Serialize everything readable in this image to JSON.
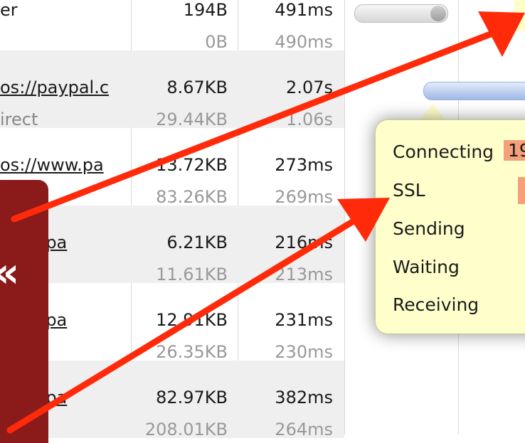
{
  "rows": [
    {
      "name": "er",
      "name_link": false,
      "sub": "",
      "size": "194B",
      "size_sub": "0B",
      "time": "491ms",
      "time_sub": "490ms",
      "shaded": false
    },
    {
      "name": "os://paypal.c",
      "name_link": true,
      "sub": "irect",
      "size": "8.67KB",
      "size_sub": "29.44KB",
      "time": "2.07s",
      "time_sub": "1.06s",
      "shaded": true
    },
    {
      "name": "os://www.pa",
      "name_link": true,
      "sub": "",
      "size": "13.72KB",
      "size_sub": "83.26KB",
      "time": "273ms",
      "time_sub": "269ms",
      "shaded": false
    },
    {
      "name": "www.pa",
      "name_link": true,
      "sub": "",
      "size": "6.21KB",
      "size_sub": "11.61KB",
      "time": "216ms",
      "time_sub": "213ms",
      "shaded": true
    },
    {
      "name": "www.pa",
      "name_link": true,
      "sub": "",
      "size": "12.91KB",
      "size_sub": "26.35KB",
      "time": "231ms",
      "time_sub": "230ms",
      "shaded": false
    },
    {
      "name": "www.pa",
      "name_link": true,
      "sub": "",
      "size": "82.97KB",
      "size_sub": "208.01KB",
      "time": "382ms",
      "time_sub": "264ms",
      "shaded": true
    }
  ],
  "tooltip": {
    "items": [
      "Connecting",
      "SSL",
      "Sending",
      "Waiting",
      "Receiving"
    ],
    "connecting_value": "19"
  },
  "panel": {
    "glyph": "«"
  },
  "colors": {
    "annotation_red": "#ff2a0a",
    "panel_red": "#8b1a1a",
    "tooltip_bg": "#ffffcc",
    "timing_swatch": "#f4a07b"
  }
}
